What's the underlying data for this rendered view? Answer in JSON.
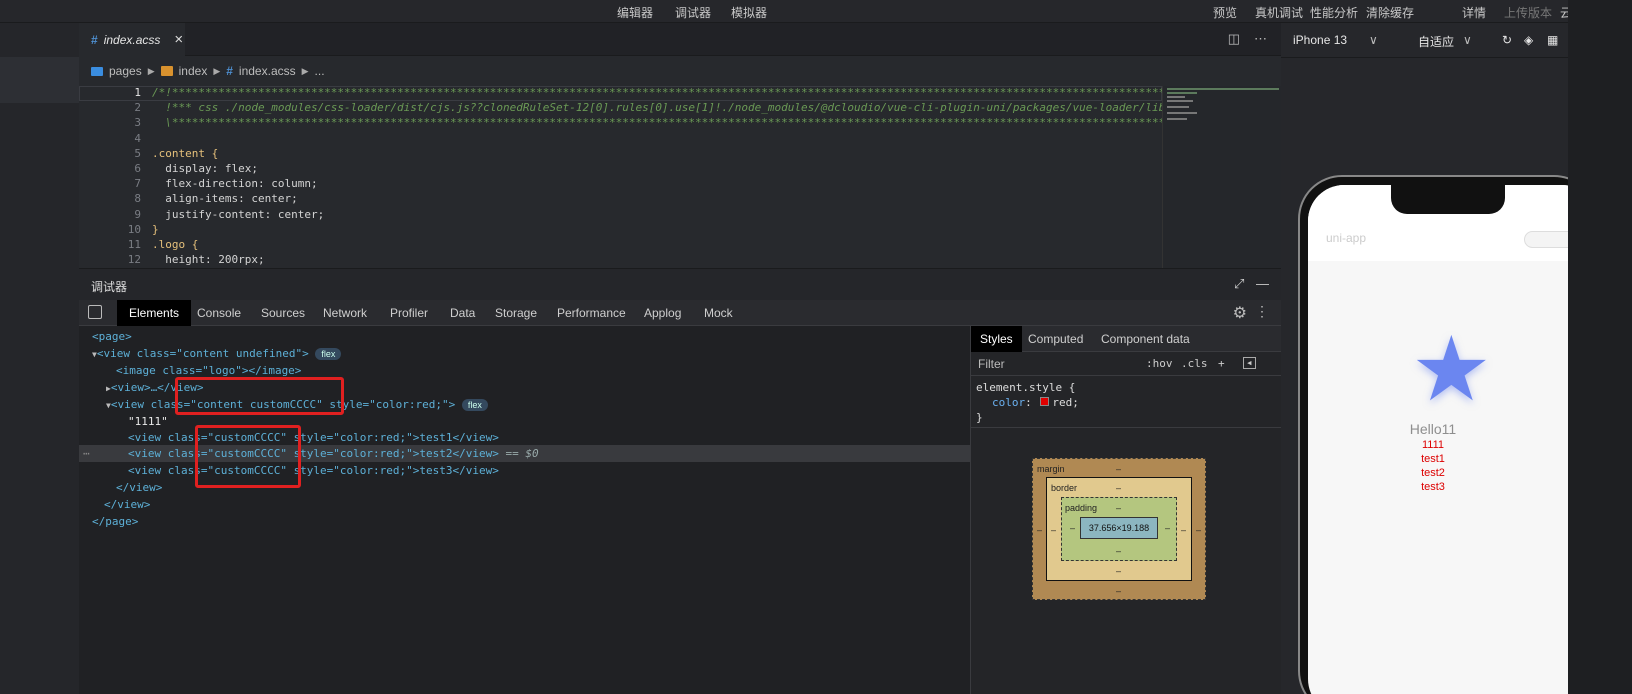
{
  "topbar": {
    "items": [
      "编辑器",
      "调试器",
      "模拟器"
    ],
    "right": [
      "预览",
      "真机调试",
      "性能分析",
      "清除缓存"
    ],
    "details": "详情",
    "upload": "上传版本",
    "cloud": "云"
  },
  "editor": {
    "tab": "index.acss",
    "breadcrumb": [
      "pages",
      "index",
      "index.acss",
      "..."
    ],
    "lines": [
      "1",
      "2",
      "3",
      "4",
      "5",
      "6",
      "7",
      "8",
      "9",
      "10",
      "11",
      "12"
    ],
    "code": [
      "/*!************************************************************************************************************************************************************",
      "  !*** css ./node_modules/css-loader/dist/cjs.js??clonedRuleSet-12[0].rules[0].use[1]!./node_modules/@dcloudio/vue-cli-plugin-uni/packages/vue-loader/lib/loaders/stylePostLoader.js",
      "  \\************************************************************************************************************************************************************/",
      "",
      ".content {",
      "  display: flex;",
      "  flex-direction: column;",
      "  align-items: center;",
      "  justify-content: center;",
      "}",
      ".logo {",
      "  height: 200rpx;"
    ]
  },
  "debugger": {
    "title": "调试器"
  },
  "devtools": {
    "tabs": [
      "Elements",
      "Console",
      "Sources",
      "Network",
      "Profiler",
      "Data",
      "Storage",
      "Performance",
      "Applog",
      "Mock"
    ]
  },
  "dom": {
    "l1": "<page>",
    "l2a": "<view class=\"content undefined\">",
    "flex": "flex",
    "l3": "<image class=\"logo\"></image>",
    "l4": "<view>…</view>",
    "l5a": "<view class=\"content customCCCC\" style=\"color:red;\">",
    "l6": "\"1111\"",
    "l7": "<view class=\"customCCCC\" style=\"color:red;\">test1</view>",
    "l8": "<view class=\"customCCCC\" style=\"color:red;\">test2</view>",
    "l8eq": " == $0",
    "l9": "<view class=\"customCCCC\" style=\"color:red;\">test3</view>",
    "l10": "</view>",
    "l11": "</view>",
    "l12": "</page>"
  },
  "styles": {
    "tabs": [
      "Styles",
      "Computed",
      "Component data"
    ],
    "filter_placeholder": "Filter",
    "hov": ":hov",
    "cls": ".cls",
    "rule_selector": "element.style {",
    "prop": "color",
    "value": "red;",
    "close": "}",
    "box": {
      "margin": "margin",
      "border": "border",
      "padding": "padding",
      "content": "37.656×19.188",
      "dash": "–"
    }
  },
  "simulator": {
    "device": "iPhone 13",
    "mode": "自适应",
    "back_title": "uni-app",
    "hello": "Hello11",
    "texts": [
      "1111",
      "test1",
      "test2",
      "test3"
    ]
  }
}
